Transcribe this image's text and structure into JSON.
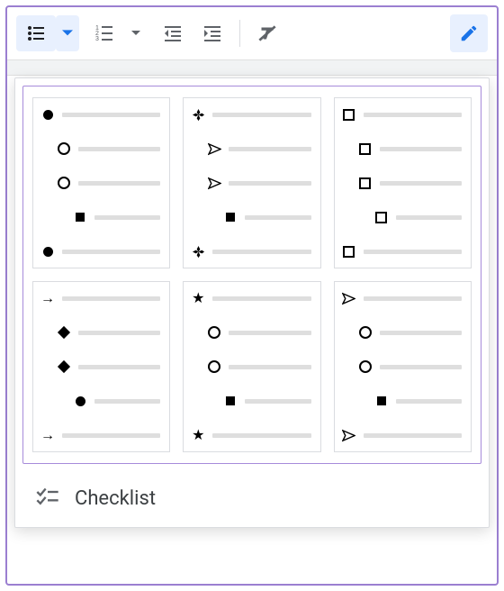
{
  "toolbar": {
    "bulleted_list": "Bulleted list",
    "numbered_list": "Numbered list",
    "decrease_indent": "Decrease indent",
    "increase_indent": "Increase indent",
    "clear_formatting": "Clear formatting",
    "editing_mode": "Editing mode"
  },
  "presets": [
    {
      "id": "disc-circle-square",
      "levels": [
        "disc",
        "circle",
        "circle",
        "square",
        "disc"
      ]
    },
    {
      "id": "fourdiamond-send-square",
      "levels": [
        "4diamond",
        "send",
        "send",
        "square",
        "4diamond"
      ]
    },
    {
      "id": "open-squares",
      "levels": [
        "square-open",
        "square-open",
        "square-open",
        "square-open",
        "square-open"
      ]
    },
    {
      "id": "arrow-diamond-disc",
      "levels": [
        "arrow",
        "diamond-fill",
        "diamond-fill",
        "disc",
        "arrow"
      ]
    },
    {
      "id": "star-circle-square",
      "levels": [
        "star",
        "circle",
        "circle",
        "square",
        "star"
      ]
    },
    {
      "id": "send-circle-square",
      "levels": [
        "send",
        "circle",
        "circle",
        "square",
        "send"
      ]
    }
  ],
  "checklist_label": "Checklist"
}
